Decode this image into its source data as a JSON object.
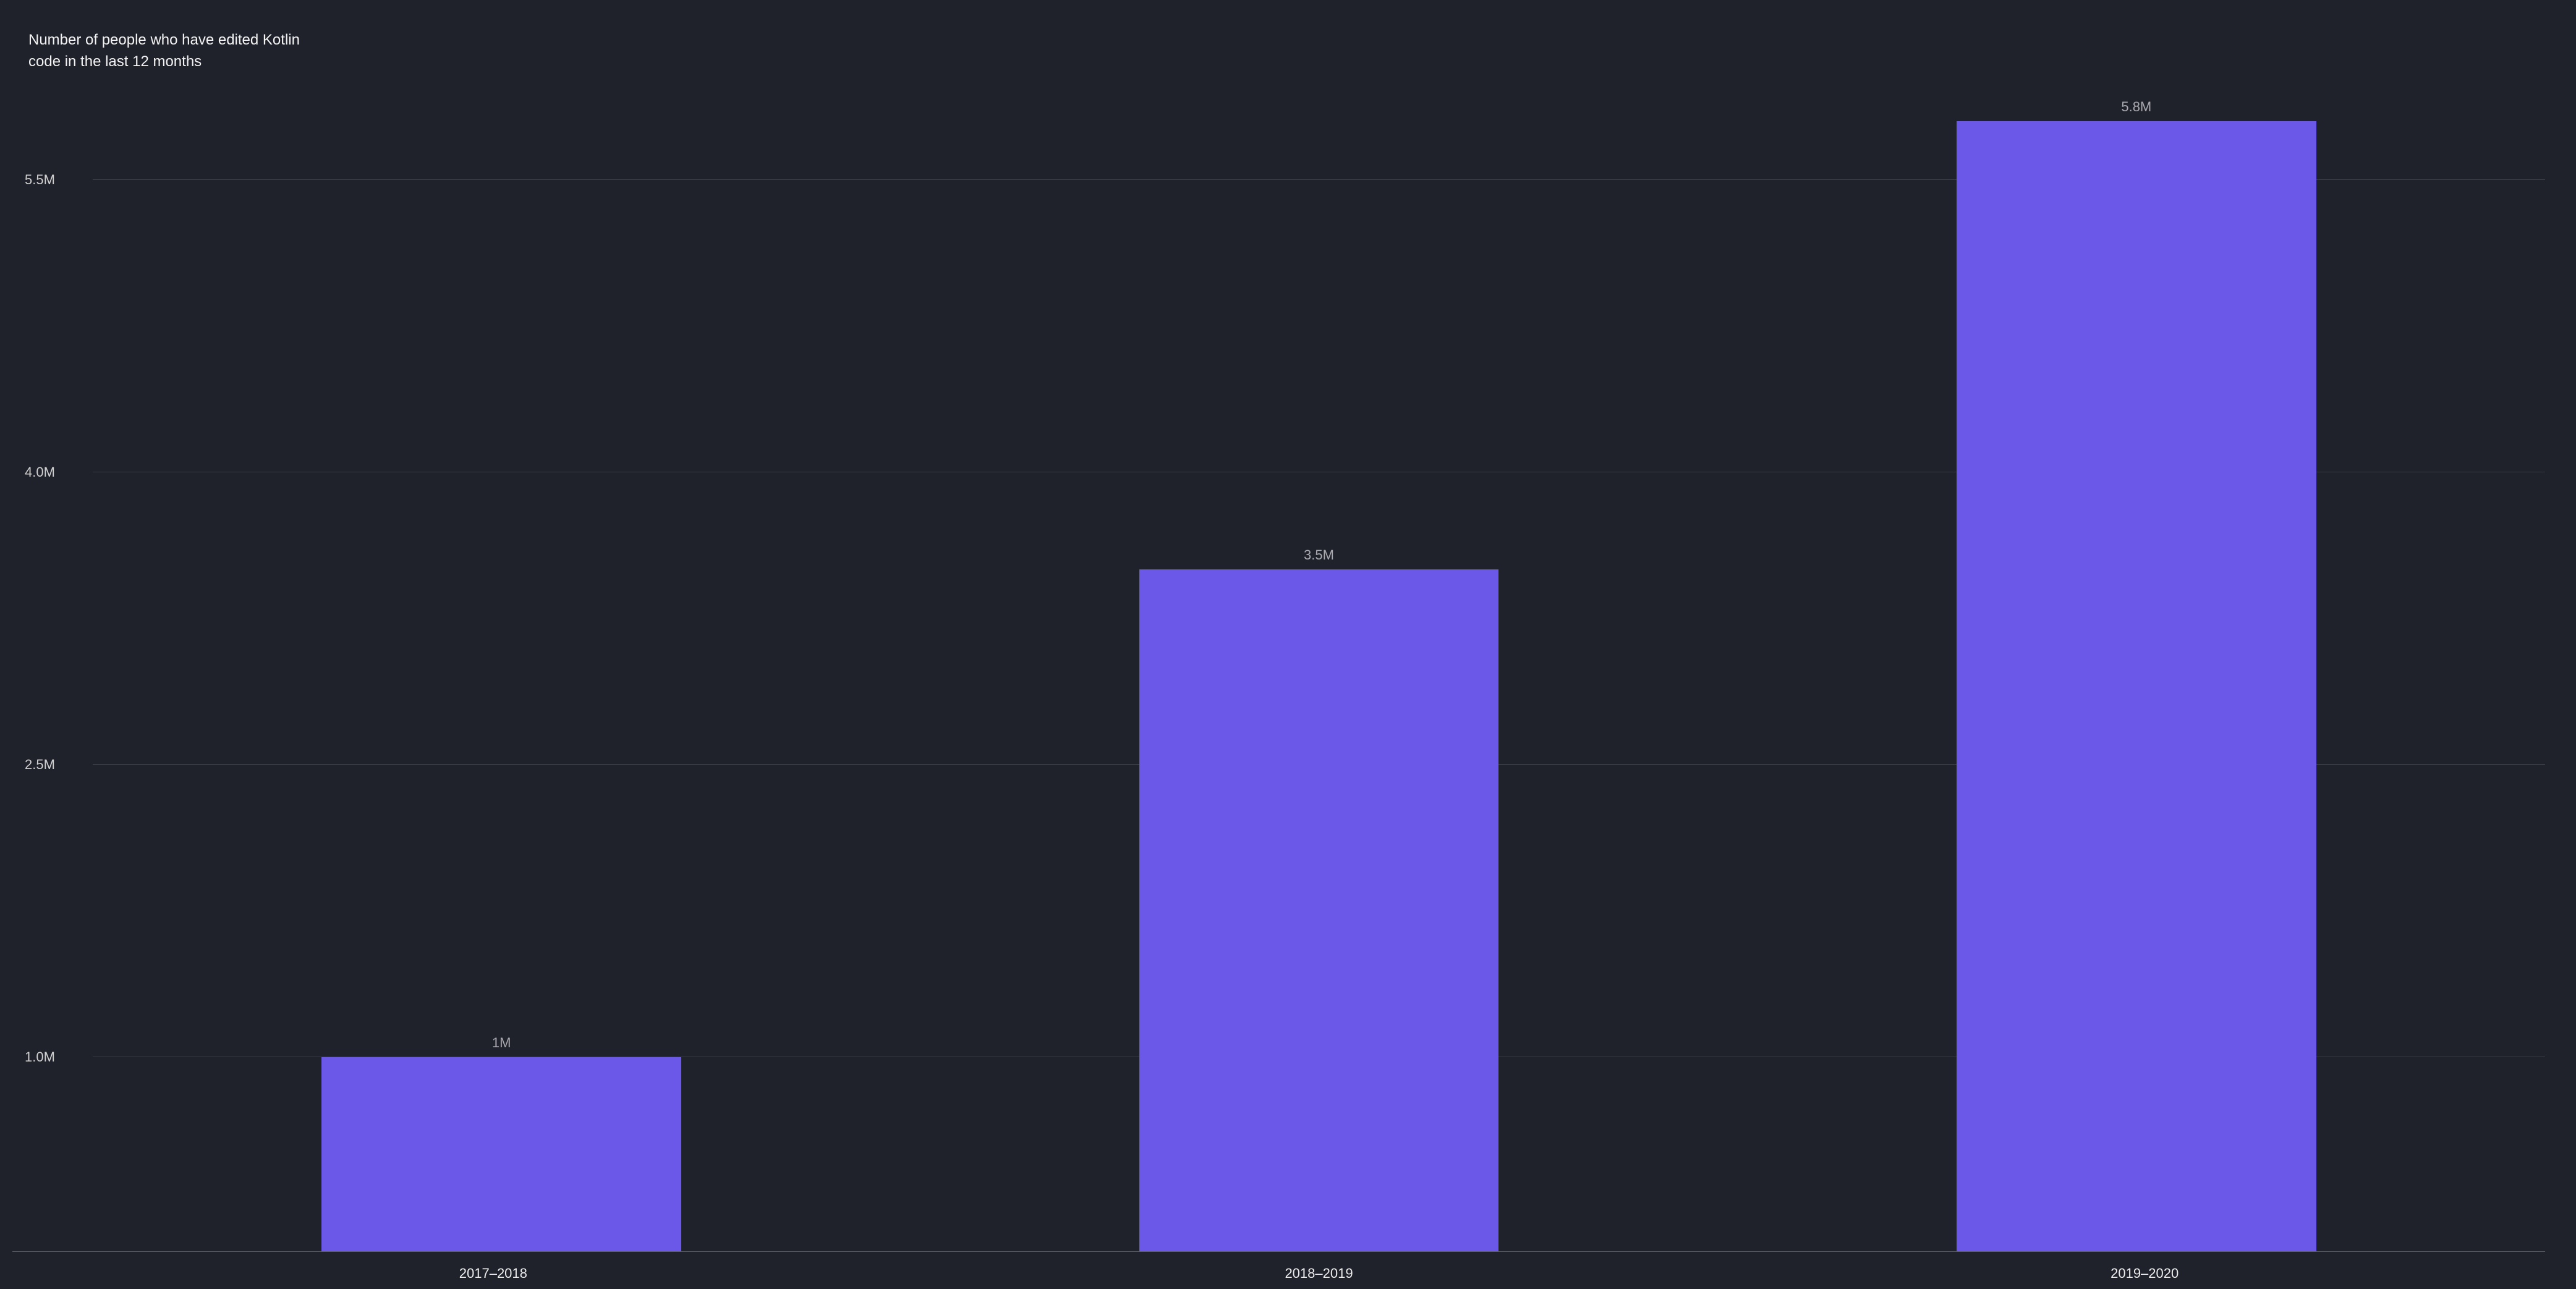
{
  "chart_data": {
    "type": "bar",
    "title": "Number of people who have edited Kotlin\ncode in the last 12 months",
    "xlabel": "",
    "ylabel": "",
    "categories": [
      "2017–2018",
      "2018–2019",
      "2019–2020"
    ],
    "values": [
      1.0,
      3.5,
      5.8
    ],
    "value_labels": [
      "1M",
      "3.5M",
      "5.8M"
    ],
    "y_ticks": [
      1.0,
      2.5,
      4.0,
      5.5
    ],
    "y_tick_labels": [
      "1.0M",
      "2.5M",
      "4.0M",
      "5.5M"
    ],
    "ylim": [
      0,
      6.2
    ],
    "unit": "M",
    "bar_color": "#6b57e8"
  }
}
